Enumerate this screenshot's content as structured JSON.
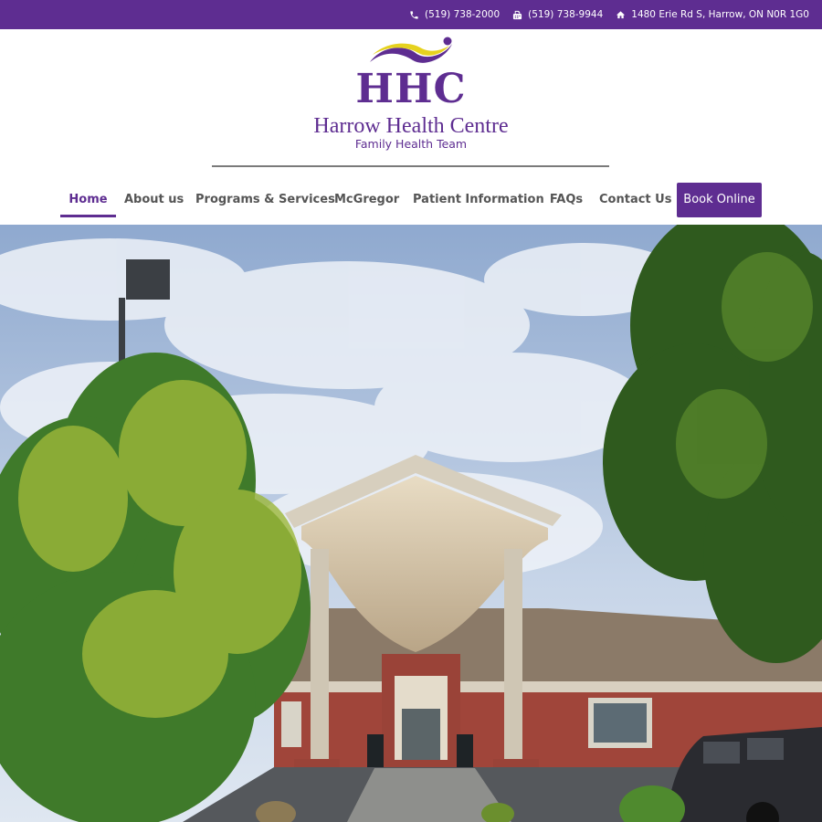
{
  "contact": {
    "phone": "(519) 738-2000",
    "fax": "(519) 738-9944",
    "address": "1480 Erie Rd S, Harrow, ON N0R 1G0"
  },
  "logo": {
    "initials": "HHC",
    "name": "Harrow Health Centre",
    "tagline": "Family Health Team"
  },
  "nav": {
    "items": [
      {
        "label": "Home",
        "active": true
      },
      {
        "label": "About us"
      },
      {
        "label": "Programs & Services"
      },
      {
        "label": "McGregor"
      },
      {
        "label": "Patient Information"
      },
      {
        "label": "FAQs"
      },
      {
        "label": "Contact Us"
      }
    ],
    "cta": "Book Online"
  },
  "icons": {
    "phone": "phone-icon",
    "fax": "fax-icon",
    "address": "home-icon"
  },
  "colors": {
    "brand_purple": "#5e2d91",
    "logo_yellow": "#e6d21e",
    "nav_text": "#555555"
  }
}
